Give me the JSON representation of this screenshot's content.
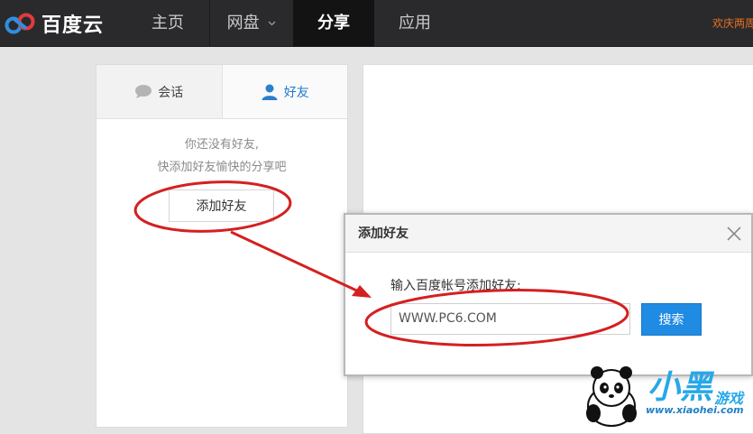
{
  "header": {
    "logo_text": "百度云",
    "nav": [
      {
        "label": "主页"
      },
      {
        "label": "网盘"
      },
      {
        "label": "分享",
        "active": true
      },
      {
        "label": "应用"
      }
    ],
    "dropdown_icon": "chevron-down-icon",
    "promo_text": "欢庆两周"
  },
  "friends_panel": {
    "tabs": [
      {
        "label": "会话",
        "icon": "chat-bubble-icon"
      },
      {
        "label": "好友",
        "icon": "user-icon",
        "active": true
      }
    ],
    "empty_line1": "你还没有好友,",
    "empty_line2": "快添加好友愉快的分享吧",
    "add_button_label": "添加好友"
  },
  "add_friend_dialog": {
    "title": "添加好友",
    "prompt": "输入百度帐号添加好友:",
    "input_value": "WWW.PC6.COM",
    "search_button_label": "搜索",
    "close_icon": "close-icon"
  },
  "watermark": {
    "big": "小黑",
    "small": "游戏",
    "url": "www.xiaohei.com"
  },
  "colors": {
    "topbar": "#2a2a2d",
    "accent_blue": "#1f8be3",
    "annotation_red": "#d42020",
    "promo_orange": "#e8731e"
  }
}
